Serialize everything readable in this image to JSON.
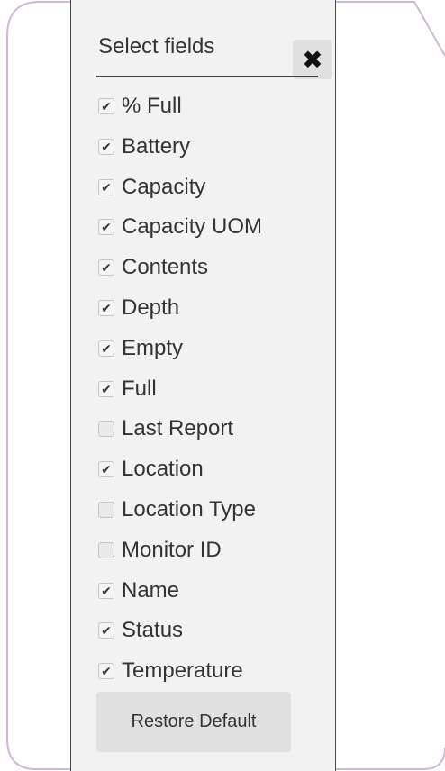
{
  "header": {
    "title": "Select fields",
    "close_glyph": "✖"
  },
  "fields": [
    {
      "label": "% Full",
      "checked": true
    },
    {
      "label": "Battery",
      "checked": true
    },
    {
      "label": "Capacity",
      "checked": true
    },
    {
      "label": "Capacity UOM",
      "checked": true
    },
    {
      "label": "Contents",
      "checked": true
    },
    {
      "label": "Depth",
      "checked": true
    },
    {
      "label": "Empty",
      "checked": true
    },
    {
      "label": "Full",
      "checked": true
    },
    {
      "label": "Last Report",
      "checked": false
    },
    {
      "label": "Location",
      "checked": true
    },
    {
      "label": "Location Type",
      "checked": false
    },
    {
      "label": "Monitor ID",
      "checked": false
    },
    {
      "label": "Name",
      "checked": true
    },
    {
      "label": "Status",
      "checked": true
    },
    {
      "label": "Temperature",
      "checked": true
    }
  ],
  "restore_label": "Restore Default",
  "colors": {
    "frame": "#cdb8d5",
    "panel": "#f2f2f2",
    "button": "#e0e0e0"
  },
  "icons": {
    "close": "close-icon",
    "check": "check-icon"
  }
}
